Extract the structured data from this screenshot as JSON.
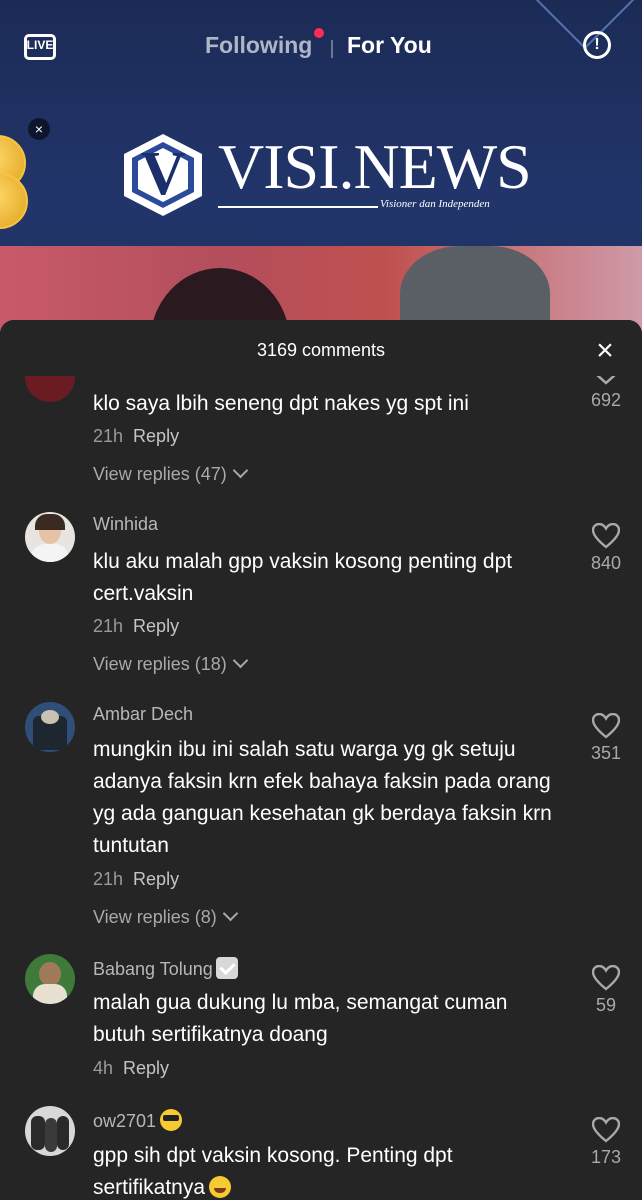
{
  "topbar": {
    "live_label": "LIVE",
    "following_label": "Following",
    "foryou_label": "For You",
    "alert_label": "!"
  },
  "video": {
    "logo_text": "VISI.NEWS",
    "logo_tagline": "Visioner dan Independen",
    "logo_mark": "V",
    "coin_close": "×"
  },
  "sheet": {
    "comment_count": "3169 comments",
    "close_label": "×"
  },
  "comments": [
    {
      "username": "",
      "text": "klo saya lbih seneng dpt nakes yg spt ini",
      "time": "21h",
      "reply_label": "Reply",
      "view_replies": "View replies (47)",
      "likes": "692"
    },
    {
      "username": "Winhida",
      "text": "klu aku malah gpp vaksin kosong penting dpt cert.vaksin",
      "time": "21h",
      "reply_label": "Reply",
      "view_replies": "View replies (18)",
      "likes": "840"
    },
    {
      "username": "Ambar Dech",
      "text": "mungkin ibu ini salah satu warga yg gk setuju adanya faksin krn efek bahaya faksin pada orang yg ada ganguan kesehatan gk berdaya faksin krn tuntutan",
      "time": "21h",
      "reply_label": "Reply",
      "view_replies": "View replies (8)",
      "likes": "351"
    },
    {
      "username": "Babang Tolung",
      "text": "malah gua dukung lu mba, semangat cuman butuh sertifikatnya doang",
      "time": "4h",
      "reply_label": "Reply",
      "view_replies": "",
      "likes": "59"
    },
    {
      "username": "ow2701",
      "text": "gpp sih dpt vaksin kosong. Penting dpt sertifikatnya",
      "time": "",
      "reply_label": "",
      "view_replies": "",
      "likes": "173"
    }
  ],
  "colors": {
    "accent": "#fe2c55",
    "sheet_bg": "#252525",
    "video_bg": "#1c2b56"
  }
}
